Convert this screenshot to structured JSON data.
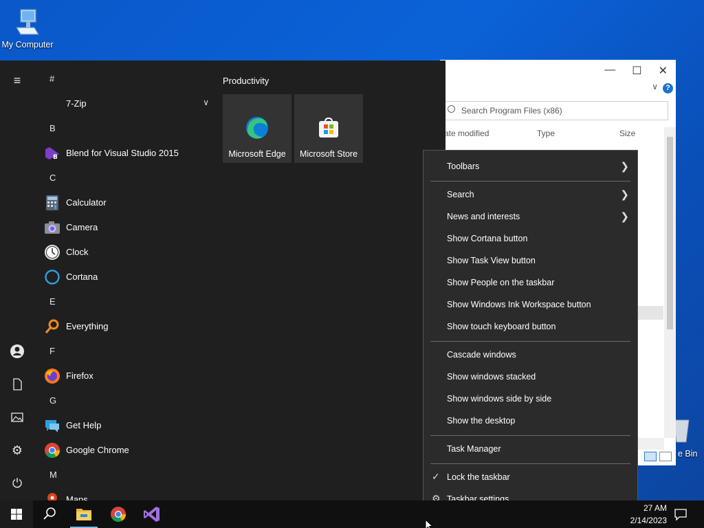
{
  "desktop": {
    "my_computer": "My Computer",
    "recycle_bin_partial": "e Bin"
  },
  "explorer": {
    "search_placeholder": "Search Program Files (x86)",
    "col_date": "ate modified",
    "col_type": "Type",
    "col_size": "Size",
    "help": "?"
  },
  "start_menu": {
    "tiles_group": "Productivity",
    "tiles": [
      {
        "label": "Microsoft Edge"
      },
      {
        "label": "Microsoft Store"
      }
    ],
    "list": [
      {
        "kind": "letter",
        "text": "#"
      },
      {
        "kind": "app",
        "text": "7-Zip",
        "icon": "folder-icon"
      },
      {
        "kind": "letter",
        "text": "B"
      },
      {
        "kind": "app",
        "text": "Blend for Visual Studio 2015",
        "icon": "blend-icon"
      },
      {
        "kind": "letter",
        "text": "C"
      },
      {
        "kind": "app",
        "text": "Calculator",
        "icon": "calculator-icon"
      },
      {
        "kind": "app",
        "text": "Camera",
        "icon": "camera-icon"
      },
      {
        "kind": "app",
        "text": "Clock",
        "icon": "clock-icon"
      },
      {
        "kind": "app",
        "text": "Cortana",
        "icon": "cortana-icon"
      },
      {
        "kind": "letter",
        "text": "E"
      },
      {
        "kind": "app",
        "text": "Everything",
        "icon": "everything-icon"
      },
      {
        "kind": "letter",
        "text": "F"
      },
      {
        "kind": "app",
        "text": "Firefox",
        "icon": "firefox-icon"
      },
      {
        "kind": "letter",
        "text": "G"
      },
      {
        "kind": "app",
        "text": "Get Help",
        "icon": "get-help-icon"
      },
      {
        "kind": "app",
        "text": "Google Chrome",
        "icon": "chrome-icon"
      },
      {
        "kind": "letter",
        "text": "M"
      },
      {
        "kind": "app",
        "text": "Maps",
        "icon": "maps-icon"
      }
    ]
  },
  "context_menu": {
    "items": [
      {
        "label": "Toolbars",
        "submenu": true
      },
      {
        "sep": true
      },
      {
        "label": "Search",
        "submenu": true
      },
      {
        "label": "News and interests",
        "submenu": true
      },
      {
        "label": "Show Cortana button"
      },
      {
        "label": "Show Task View button"
      },
      {
        "label": "Show People on the taskbar"
      },
      {
        "label": "Show Windows Ink Workspace button"
      },
      {
        "label": "Show touch keyboard button"
      },
      {
        "sep": true
      },
      {
        "label": "Cascade windows"
      },
      {
        "label": "Show windows stacked"
      },
      {
        "label": "Show windows side by side"
      },
      {
        "label": "Show the desktop"
      },
      {
        "sep": true
      },
      {
        "label": "Task Manager"
      },
      {
        "sep": true
      },
      {
        "label": "Lock the taskbar",
        "checked": true
      },
      {
        "label": "Taskbar settings",
        "gear": true
      }
    ]
  },
  "taskbar": {
    "time": "27 AM",
    "date": "2/14/2023"
  },
  "colors": {
    "start_bg": "#1f1f1f",
    "menu_bg": "#2b2b2b",
    "taskbar_bg": "#101010",
    "desktop_blue": "#0a58c9"
  }
}
